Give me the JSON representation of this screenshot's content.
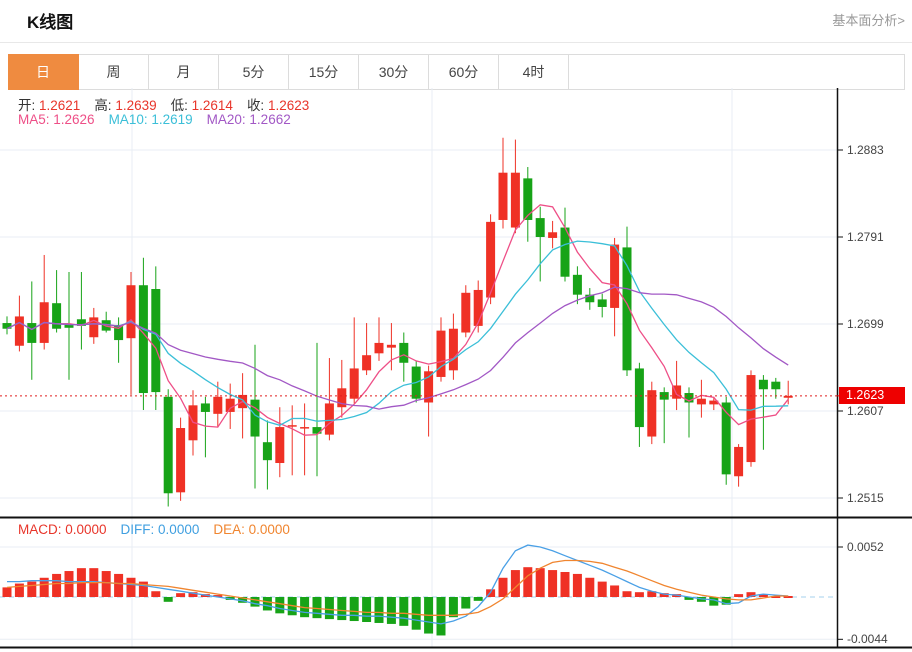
{
  "header": {
    "title": "K线图",
    "link": "基本面分析>"
  },
  "tabs": {
    "items": [
      "日",
      "周",
      "月",
      "5分",
      "15分",
      "30分",
      "60分",
      "4时"
    ],
    "active": "日",
    "active_index": 0,
    "active_color": "#ef8b40"
  },
  "legend": {
    "ohlc": [
      {
        "label": "开:",
        "value": "1.2621"
      },
      {
        "label": "高:",
        "value": "1.2639"
      },
      {
        "label": "低:",
        "value": "1.2614"
      },
      {
        "label": "收:",
        "value": "1.2623"
      }
    ],
    "value_color": "#e8352a",
    "ma": [
      {
        "label": "MA5:",
        "value": "1.2626",
        "color": "#ee4f87"
      },
      {
        "label": "MA10:",
        "value": "1.2619",
        "color": "#3bbfd8"
      },
      {
        "label": "MA20:",
        "value": "1.2662",
        "color": "#a258c5"
      }
    ]
  },
  "macd_legend": [
    {
      "label": "MACD:",
      "value": "0.0000",
      "color": "#e8352a"
    },
    {
      "label": "DIFF:",
      "value": "0.0000",
      "color": "#3f9fe0"
    },
    {
      "label": "DEA:",
      "value": "0.0000",
      "color": "#f0852f"
    }
  ],
  "axis": {
    "price_labels": [
      "1.2883",
      "1.2791",
      "1.2699",
      "1.2607",
      "1.2515"
    ],
    "price_tag": "1.2623",
    "macd_labels": [
      "0.0052",
      "-0.0044"
    ]
  },
  "chart_data": {
    "type": "candlestick+macd",
    "panels": [
      "price",
      "macd"
    ],
    "title": "K线图 (daily K-line with MA5/MA10/MA20 and MACD)",
    "price_axis_ticks": [
      1.2883,
      1.2791,
      1.2699,
      1.2607,
      1.2515
    ],
    "current_price": 1.2623,
    "last_candle": {
      "open": 1.2621,
      "high": 1.2639,
      "low": 1.2614,
      "close": 1.2623
    },
    "ma_periods": [
      5,
      10,
      20
    ],
    "ma_last_values": {
      "MA5": 1.2626,
      "MA10": 1.2619,
      "MA20": 1.2662
    },
    "ma_colors": [
      "#ee4f87",
      "#3bbfd8",
      "#a258c5"
    ],
    "up_color": "#ef3125",
    "down_color": "#17a317",
    "grid": true,
    "candles": [
      [
        1.27,
        1.2707,
        1.2688,
        1.2694
      ],
      [
        1.2676,
        1.2729,
        1.267,
        1.2707
      ],
      [
        1.27,
        1.2744,
        1.264,
        1.2679
      ],
      [
        1.2679,
        1.2772,
        1.2672,
        1.2722
      ],
      [
        1.2721,
        1.2756,
        1.269,
        1.2694
      ],
      [
        1.2699,
        1.2754,
        1.264,
        1.2695
      ],
      [
        1.2704,
        1.2754,
        1.2672,
        1.2697
      ],
      [
        1.2685,
        1.2716,
        1.2678,
        1.2706
      ],
      [
        1.2703,
        1.2712,
        1.269,
        1.2692
      ],
      [
        1.2698,
        1.2706,
        1.2658,
        1.2682
      ],
      [
        1.2684,
        1.2754,
        1.2624,
        1.274
      ],
      [
        1.274,
        1.2769,
        1.2608,
        1.2626
      ],
      [
        1.2736,
        1.276,
        1.2608,
        1.2627
      ],
      [
        1.2622,
        1.263,
        1.2506,
        1.252
      ],
      [
        1.2521,
        1.26,
        1.2512,
        1.2589
      ],
      [
        1.2576,
        1.2629,
        1.256,
        1.2613
      ],
      [
        1.2615,
        1.2622,
        1.2558,
        1.2606
      ],
      [
        1.2604,
        1.2638,
        1.259,
        1.2622
      ],
      [
        1.2606,
        1.2636,
        1.2588,
        1.262
      ],
      [
        1.261,
        1.2647,
        1.2578,
        1.2624
      ],
      [
        1.2619,
        1.2677,
        1.2525,
        1.258
      ],
      [
        1.2574,
        1.2597,
        1.2524,
        1.2555
      ],
      [
        1.2552,
        1.2611,
        1.2537,
        1.259
      ],
      [
        1.2591,
        1.2613,
        1.2539,
        1.2592
      ],
      [
        1.2589,
        1.2615,
        1.2539,
        1.259
      ],
      [
        1.259,
        1.2679,
        1.2538,
        1.2583
      ],
      [
        1.2582,
        1.2663,
        1.2576,
        1.2615
      ],
      [
        1.2611,
        1.2661,
        1.26,
        1.2631
      ],
      [
        1.262,
        1.2706,
        1.2615,
        1.2652
      ],
      [
        1.265,
        1.27,
        1.2645,
        1.2666
      ],
      [
        1.2668,
        1.2706,
        1.266,
        1.2679
      ],
      [
        1.2674,
        1.27,
        1.265,
        1.2677
      ],
      [
        1.2679,
        1.269,
        1.2638,
        1.2658
      ],
      [
        1.2654,
        1.266,
        1.2616,
        1.262
      ],
      [
        1.2616,
        1.2655,
        1.258,
        1.2649
      ],
      [
        1.2643,
        1.2706,
        1.2638,
        1.2692
      ],
      [
        1.265,
        1.271,
        1.264,
        1.2694
      ],
      [
        1.269,
        1.274,
        1.2685,
        1.2732
      ],
      [
        1.2697,
        1.2745,
        1.269,
        1.2735
      ],
      [
        1.2727,
        1.2815,
        1.272,
        1.2807
      ],
      [
        1.2809,
        1.2896,
        1.28,
        1.2859
      ],
      [
        1.2801,
        1.2894,
        1.2795,
        1.2859
      ],
      [
        1.2853,
        1.2865,
        1.2786,
        1.2809
      ],
      [
        1.2811,
        1.2823,
        1.2744,
        1.2791
      ],
      [
        1.279,
        1.2808,
        1.2779,
        1.2796
      ],
      [
        1.2801,
        1.2822,
        1.2744,
        1.2749
      ],
      [
        1.2751,
        1.276,
        1.272,
        1.273
      ],
      [
        1.273,
        1.2737,
        1.2714,
        1.2722
      ],
      [
        1.2725,
        1.2731,
        1.2706,
        1.2717
      ],
      [
        1.2716,
        1.279,
        1.2686,
        1.2783
      ],
      [
        1.278,
        1.2802,
        1.2644,
        1.265
      ],
      [
        1.2652,
        1.2658,
        1.2569,
        1.259
      ],
      [
        1.258,
        1.2638,
        1.2572,
        1.2629
      ],
      [
        1.2627,
        1.2632,
        1.2573,
        1.2619
      ],
      [
        1.262,
        1.266,
        1.2608,
        1.2634
      ],
      [
        1.2626,
        1.2632,
        1.2579,
        1.2616
      ],
      [
        1.2614,
        1.264,
        1.26,
        1.262
      ],
      [
        1.2614,
        1.2622,
        1.2608,
        1.2618
      ],
      [
        1.2616,
        1.2622,
        1.2529,
        1.254
      ],
      [
        1.2538,
        1.2572,
        1.2527,
        1.2569
      ],
      [
        1.2553,
        1.265,
        1.2548,
        1.2645
      ],
      [
        1.264,
        1.2645,
        1.2566,
        1.263
      ],
      [
        1.2638,
        1.2642,
        1.262,
        1.263
      ],
      [
        1.2621,
        1.2639,
        1.2614,
        1.2623
      ]
    ],
    "macd": {
      "unit": 0.0001,
      "axis_ticks": [
        0.0052,
        -0.0044
      ],
      "last_values": {
        "MACD": 0.0,
        "DIFF": 0.0,
        "DEA": 0.0
      },
      "diff_color": "#4aa0e6",
      "dea_color": "#f0852f",
      "hist": [
        10,
        14,
        16,
        20,
        24,
        27,
        30,
        30,
        27,
        24,
        20,
        16,
        6,
        -5,
        4,
        5,
        3,
        2,
        -3,
        -6,
        -10,
        -14,
        -17,
        -19,
        -21,
        -22,
        -23,
        -24,
        -25,
        -26,
        -27,
        -28,
        -30,
        -34,
        -38,
        -40,
        -21,
        -12,
        -4,
        8,
        20,
        28,
        31,
        30,
        28,
        26,
        24,
        20,
        16,
        12,
        6,
        5,
        6,
        4,
        3,
        -3,
        -5,
        -9,
        -8,
        3,
        5,
        3,
        1,
        0
      ],
      "diff": [
        16,
        16,
        17,
        17,
        17,
        16,
        16,
        16,
        15,
        14,
        13,
        12,
        10,
        8,
        6,
        4,
        2,
        0,
        -2,
        -4,
        -7,
        -9,
        -12,
        -14,
        -16,
        -17,
        -18,
        -19,
        -19,
        -20,
        -20,
        -21,
        -22,
        -24,
        -26,
        -28,
        -25,
        -20,
        -10,
        5,
        30,
        48,
        54,
        52,
        48,
        43,
        38,
        33,
        28,
        22,
        16,
        10,
        6,
        3,
        2,
        0,
        -2,
        -3,
        -7,
        -6,
        1,
        3,
        2,
        1
      ],
      "dea": [
        10,
        11,
        12,
        13,
        14,
        14,
        15,
        15,
        15,
        14,
        14,
        13,
        12,
        11,
        9,
        7,
        5,
        3,
        1,
        -1,
        -3,
        -5,
        -7,
        -9,
        -11,
        -12,
        -13,
        -14,
        -15,
        -16,
        -16,
        -17,
        -17,
        -18,
        -19,
        -19,
        -19,
        -18,
        -16,
        -10,
        -2,
        10,
        22,
        30,
        36,
        38,
        38,
        37,
        35,
        31,
        27,
        22,
        17,
        12,
        8,
        5,
        2,
        0,
        -2,
        -3,
        -3,
        -1,
        1,
        1
      ]
    }
  }
}
